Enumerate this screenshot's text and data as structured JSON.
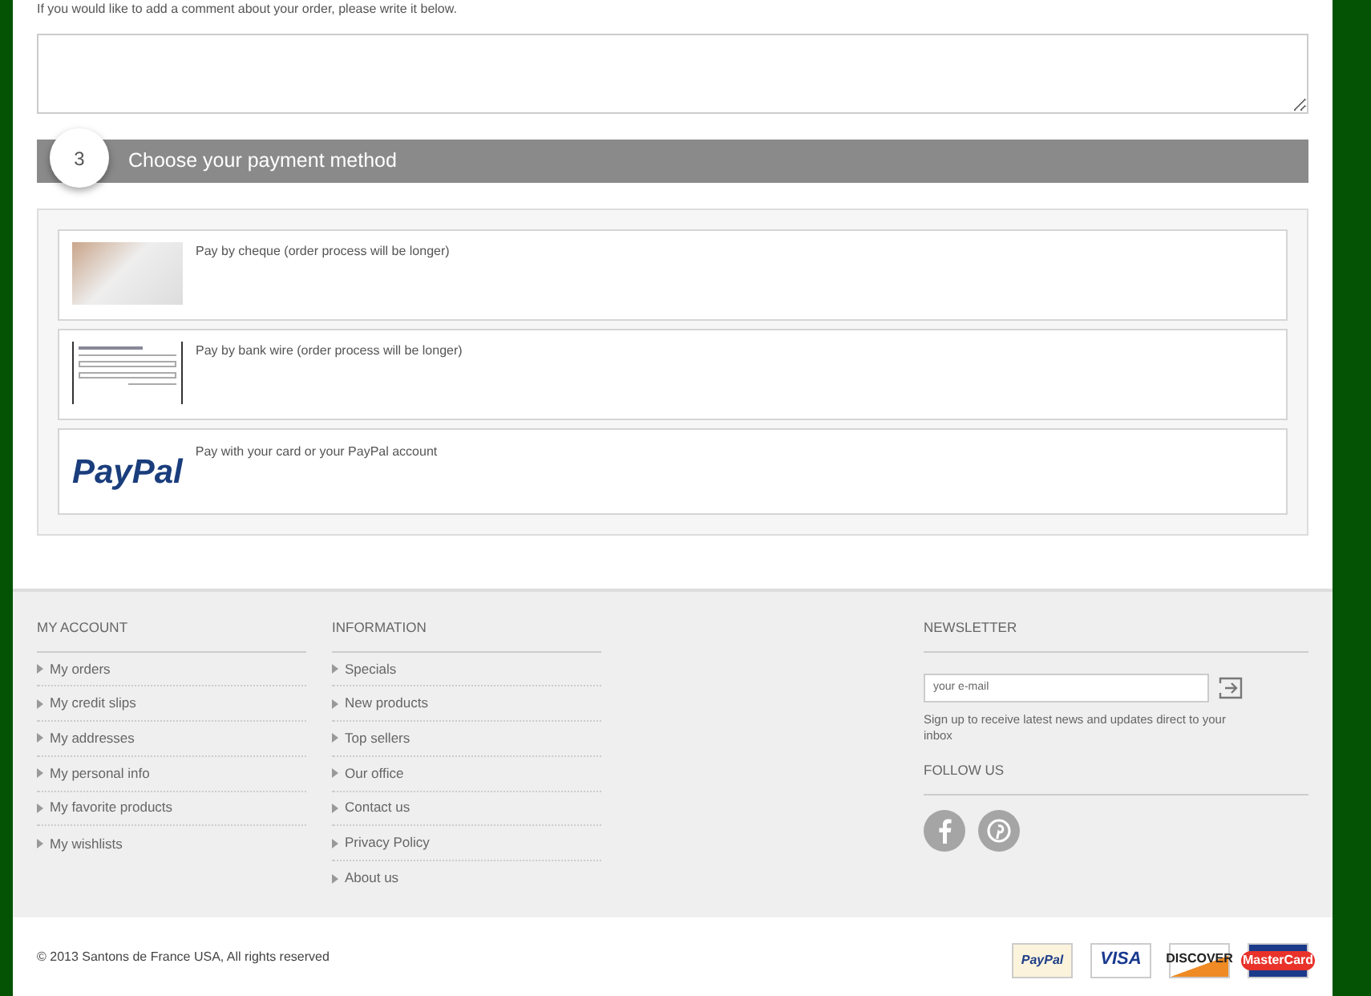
{
  "comment": {
    "prompt": "If you would like to add a comment about your order, please write it below."
  },
  "payment": {
    "step": "3",
    "title": "Choose your payment method",
    "methods": [
      {
        "kind": "cheque",
        "label": "Pay by cheque (order process will be longer)"
      },
      {
        "kind": "wire",
        "label": "Pay by bank wire (order process will be longer)"
      },
      {
        "kind": "paypal",
        "logo": "PayPal",
        "label": "Pay with your card or your PayPal account"
      }
    ]
  },
  "footer": {
    "columns": [
      {
        "title": "MY ACCOUNT",
        "items": [
          "My orders",
          "My credit slips",
          "My addresses",
          "My personal info",
          "My favorite products",
          "My wishlists"
        ]
      },
      {
        "title": "INFORMATION",
        "items": [
          "Specials",
          "New products",
          "Top sellers",
          "Our office",
          "Contact us",
          "Privacy Policy",
          "About us"
        ]
      }
    ],
    "newsletter": {
      "title": "NEWSLETTER",
      "placeholder": "your e-mail",
      "note": "Sign up to receive latest news and updates direct to your inbox"
    },
    "follow": {
      "title": "FOLLOW US",
      "networks": [
        {
          "kind": "facebook"
        },
        {
          "kind": "pinterest"
        }
      ]
    },
    "copyright": "© 2013 Santons de France USA, All rights reserved",
    "cards": [
      {
        "kind": "paypal",
        "label": "PayPal"
      },
      {
        "kind": "visa",
        "label": "VISA"
      },
      {
        "kind": "discover",
        "label": "DISCOVER"
      },
      {
        "kind": "mastercard",
        "label": "MasterCard"
      }
    ]
  }
}
